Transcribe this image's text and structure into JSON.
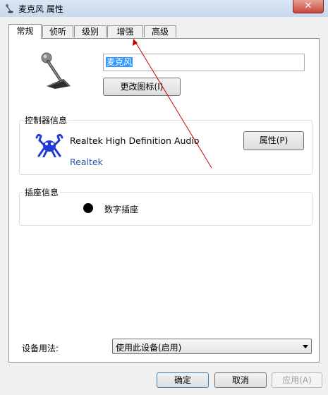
{
  "window": {
    "title": "麦克风 属性",
    "close_label": "✕"
  },
  "tabs": [
    {
      "label": "常规",
      "active": true
    },
    {
      "label": "侦听",
      "active": false
    },
    {
      "label": "级别",
      "active": false
    },
    {
      "label": "增强",
      "active": false
    },
    {
      "label": "高级",
      "active": false
    }
  ],
  "general": {
    "device_name": "麦克风",
    "change_icon_button": "更改图标(I)",
    "controller": {
      "group_label": "控制器信息",
      "name": "Realtek High Definition Audio",
      "vendor": "Realtek",
      "properties_button": "属性(P)"
    },
    "jack": {
      "group_label": "插座信息",
      "type": "数字插座"
    },
    "usage": {
      "label": "设备用法:",
      "selected": "使用此设备(启用)"
    }
  },
  "footer": {
    "ok": "确定",
    "cancel": "取消",
    "apply": "应用(A)"
  },
  "colors": {
    "annotation_arrow": "#cc0000",
    "vendor_link": "#2c56a6",
    "selection": "#3399ff"
  }
}
